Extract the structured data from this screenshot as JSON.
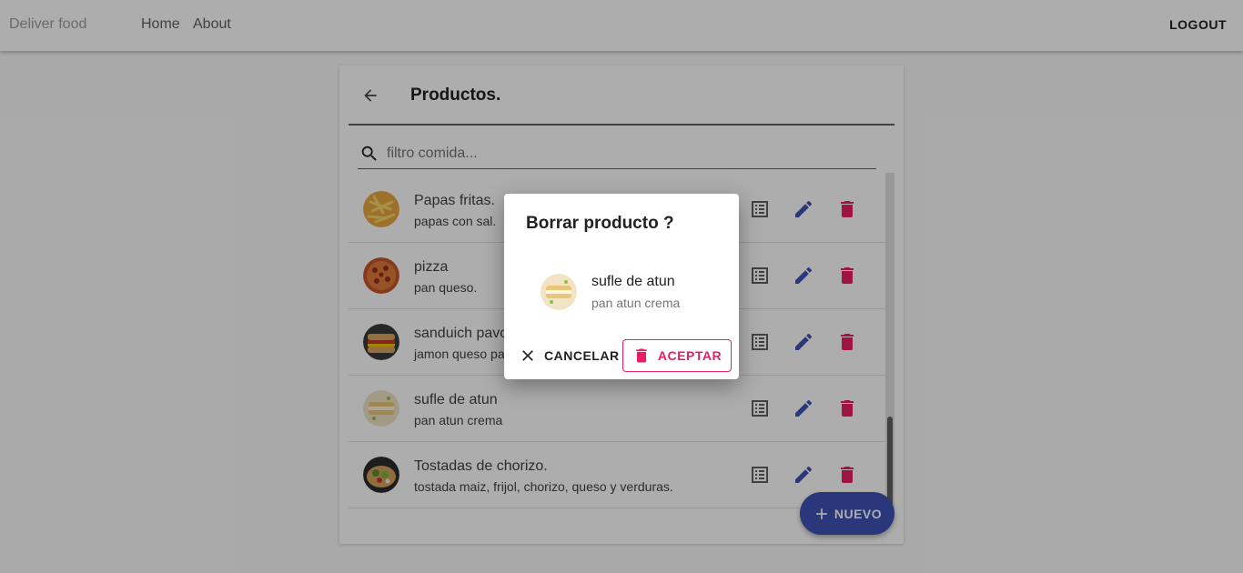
{
  "toolbar": {
    "brand": "Deliver food",
    "nav": [
      "Home",
      "About"
    ],
    "logout": "LOGOUT"
  },
  "card": {
    "title": "Productos.",
    "search_placeholder": "filtro comida...",
    "fab_label": "NUEVO",
    "products": [
      {
        "name": "Papas fritas.",
        "description": "papas con sal.",
        "icon": "fries-image"
      },
      {
        "name": "pizza",
        "description": "pan queso.",
        "icon": "pizza-image"
      },
      {
        "name": "sanduich pavo",
        "description": "jamon queso pan",
        "icon": "sandwich-image"
      },
      {
        "name": "sufle de atun",
        "description": "pan atun crema",
        "icon": "tuna-souffle-image"
      },
      {
        "name": "Tostadas de chorizo.",
        "description": "tostada maiz, frijol, chorizo, queso y verduras.",
        "icon": "tostada-image"
      }
    ]
  },
  "dialog": {
    "title": "Borrar producto ?",
    "item_name": "sufle de atun",
    "item_description": "pan atun crema",
    "cancel_label": "CANCELAR",
    "accept_label": "ACEPTAR"
  },
  "colors": {
    "primary": "#3f51b5",
    "delete": "#e91e63",
    "overlay": "rgba(0,0,0,0.32)"
  }
}
